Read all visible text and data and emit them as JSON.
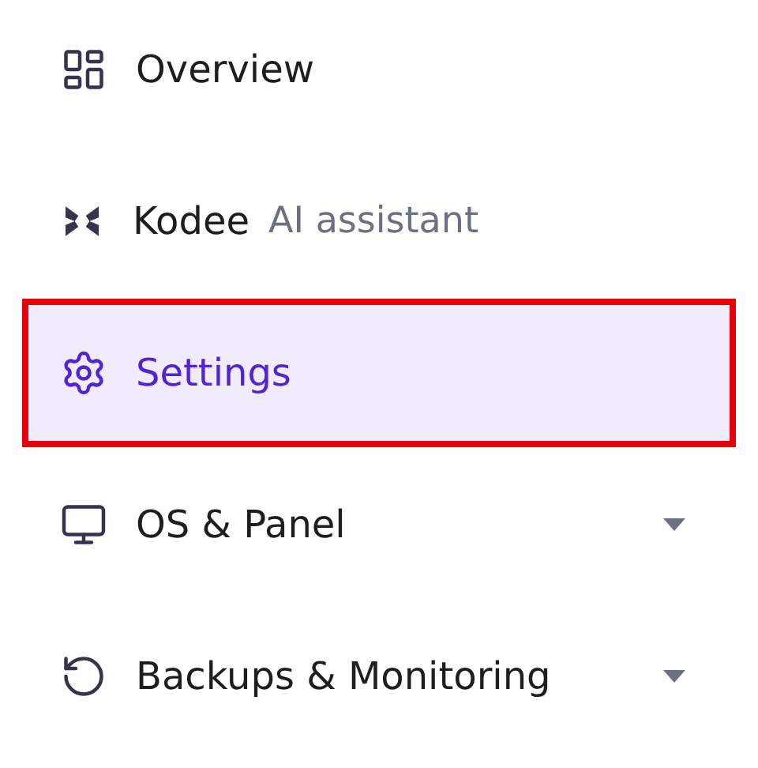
{
  "menu": [
    {
      "kind": "link",
      "label": "Overview",
      "selected": false,
      "highlighted": false
    },
    {
      "kind": "link",
      "label": "Kodee",
      "note": "AI assistant",
      "selected": false,
      "highlighted": false
    },
    {
      "kind": "link",
      "label": "Settings",
      "selected": true,
      "highlighted": true
    },
    {
      "kind": "group",
      "label": "OS & Panel",
      "selected": false,
      "highlighted": false,
      "expanded": false
    },
    {
      "kind": "group",
      "label": "Backups & Monitoring",
      "selected": false,
      "highlighted": false,
      "expanded": false
    }
  ]
}
